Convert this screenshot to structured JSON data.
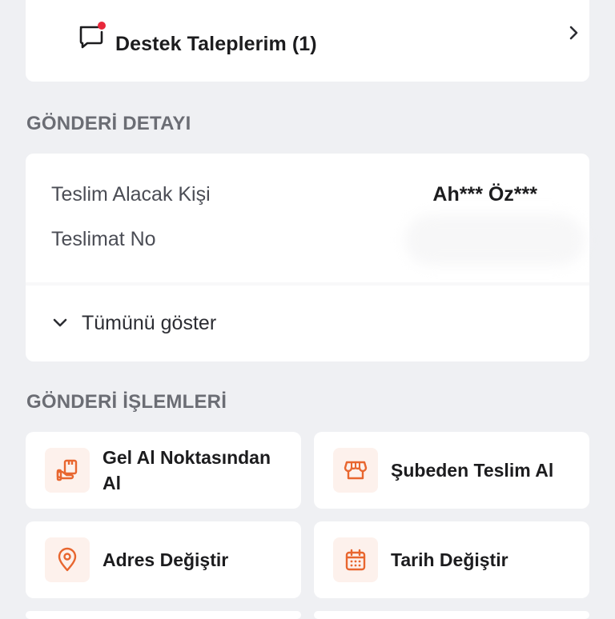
{
  "support": {
    "title": "Destek Taleplerim (1)",
    "icon": "chat-bubble-notification-icon"
  },
  "sections": {
    "detail_heading": "GÖNDERİ DETAYI",
    "actions_heading": "GÖNDERİ İŞLEMLERİ"
  },
  "detail": {
    "recipient_label": "Teslim Alacak Kişi",
    "recipient_value": "Ah*** Öz***",
    "delivery_label": "Teslimat No",
    "show_all": "Tümünü göster"
  },
  "actions": [
    {
      "label": "Gel Al Noktasından Al",
      "icon": "pickup-point-icon"
    },
    {
      "label": "Şubeden Teslim Al",
      "icon": "store-icon"
    },
    {
      "label": "Adres Değiştir",
      "icon": "location-pin-icon"
    },
    {
      "label": "Tarih Değiştir",
      "icon": "calendar-icon"
    }
  ],
  "colors": {
    "accent": "#e8662f",
    "notification": "#e8283b",
    "heading": "#6b6d74",
    "background": "#eff0f3"
  }
}
